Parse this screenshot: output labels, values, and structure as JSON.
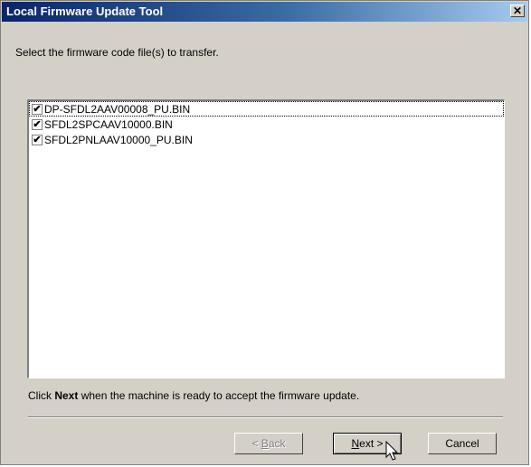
{
  "window": {
    "title": "Local Firmware Update Tool",
    "close_glyph": "✕",
    "icons": {
      "close": "close-icon",
      "check": "checkmark-icon",
      "cursor": "mouse-pointer-icon"
    }
  },
  "instruction": "Select the firmware code file(s) to transfer.",
  "files": [
    {
      "name": "DP-SFDL2AAV00008_PU.BIN",
      "checked": true
    },
    {
      "name": "SFDL2SPCAAV10000.BIN",
      "checked": true
    },
    {
      "name": "SFDL2PNLAAV10000_PU.BIN",
      "checked": true
    }
  ],
  "hint": {
    "before": "Click ",
    "bold": "Next",
    "after": " when the machine is ready to accept the firmware update."
  },
  "buttons": {
    "back": {
      "pre": "< ",
      "accel": "B",
      "rest": "ack"
    },
    "next": {
      "accel": "N",
      "rest": "ext >"
    },
    "cancel": "Cancel"
  },
  "colors": {
    "title_gradient_start": "#0a246a",
    "title_gradient_end": "#a6caf0",
    "face": "#d4d0c8"
  }
}
